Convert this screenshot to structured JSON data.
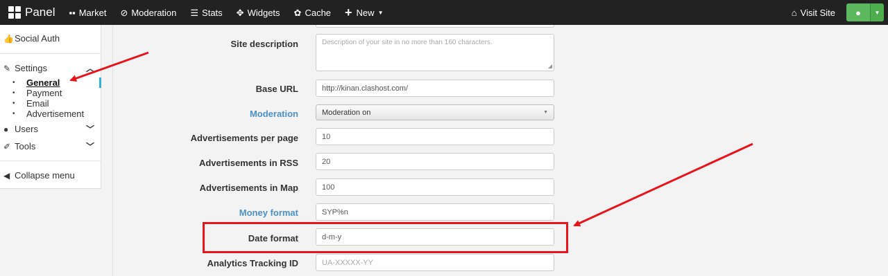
{
  "navbar": {
    "brand": "Panel",
    "items": [
      {
        "label": "Market",
        "icon": "grid-icon"
      },
      {
        "label": "Moderation",
        "icon": "ban-icon"
      },
      {
        "label": "Stats",
        "icon": "bars-icon"
      },
      {
        "label": "Widgets",
        "icon": "move-icon"
      },
      {
        "label": "Cache",
        "icon": "gear-icon"
      },
      {
        "label": "New",
        "icon": "plus-icon"
      }
    ],
    "visit_site": "Visit Site"
  },
  "sidebar": {
    "social_auth": "Social Auth",
    "settings": "Settings",
    "sub_items": [
      "General",
      "Payment",
      "Email",
      "Advertisement"
    ],
    "active_sub_item": "General",
    "users": "Users",
    "tools": "Tools",
    "collapse": "Collapse menu"
  },
  "form": {
    "site_description": {
      "label": "Site description",
      "placeholder": "Description of your site in no more than 160 characters."
    },
    "base_url": {
      "label": "Base URL",
      "value": "http://kinan.clashost.com/"
    },
    "moderation": {
      "label": "Moderation",
      "value": "Moderation on"
    },
    "ads_per_page": {
      "label": "Advertisements per page",
      "value": "10"
    },
    "ads_in_rss": {
      "label": "Advertisements in RSS",
      "value": "20"
    },
    "ads_in_map": {
      "label": "Advertisements in Map",
      "value": "100"
    },
    "money_format": {
      "label": "Money format",
      "value": "SYP%n"
    },
    "date_format": {
      "label": "Date format",
      "value": "d-m-y"
    },
    "analytics_id": {
      "label": "Analytics Tracking ID",
      "placeholder": "UA-XXXXX-YY"
    }
  },
  "colors": {
    "navbar_bg": "#222222",
    "accent_link": "#4a90c9",
    "user_button": "#5cb85c",
    "annotation_red": "#e8141a"
  }
}
